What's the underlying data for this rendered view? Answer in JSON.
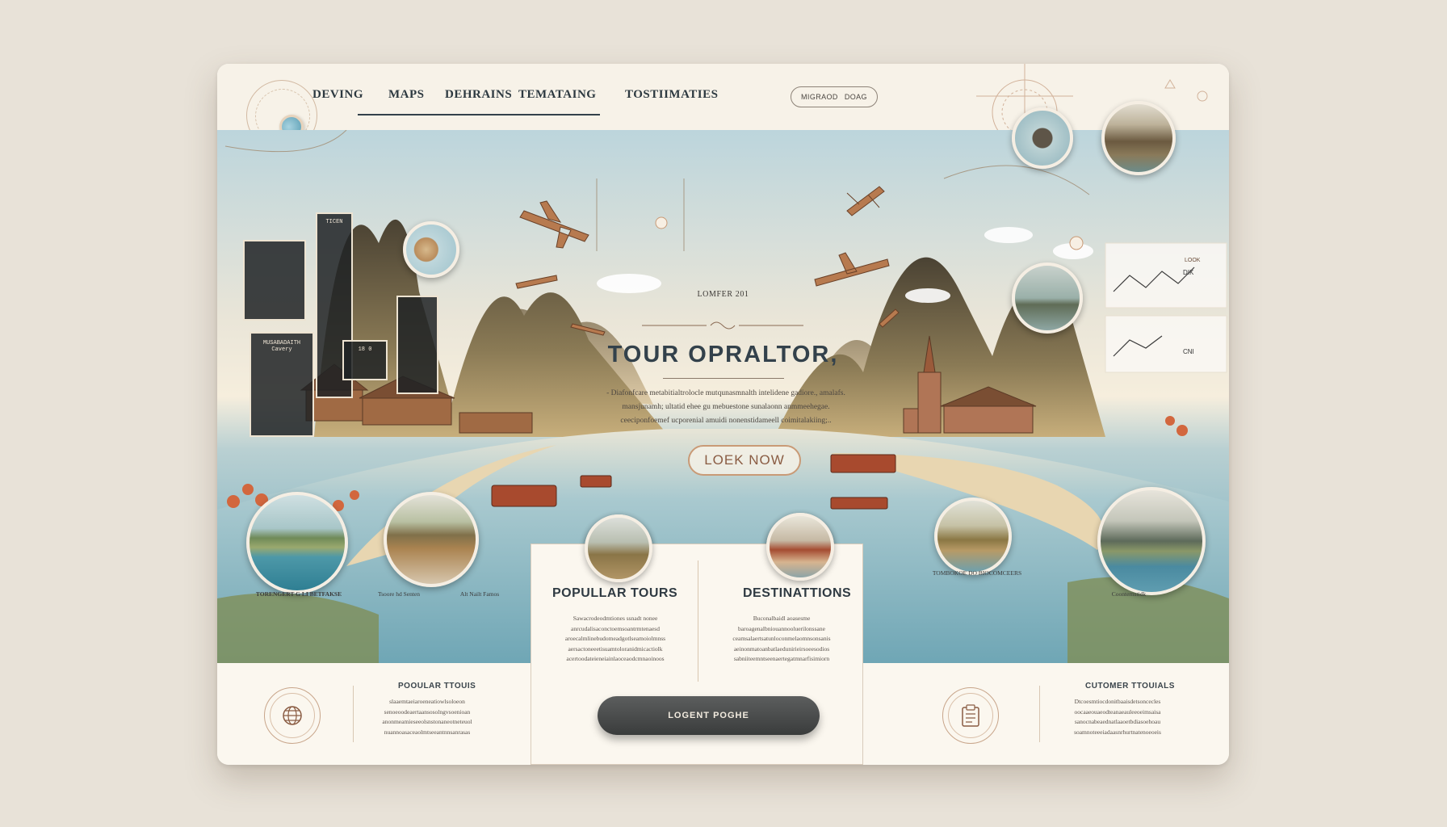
{
  "nav": {
    "items": [
      "DEVING",
      "MAPS",
      "DEHRAINS",
      "TEMATAING",
      "TOSTIIMATIES"
    ],
    "search_label": "MIGRAOD",
    "search_sub": "DOAG"
  },
  "hero": {
    "subtitle": "LOMFER 201",
    "title": "TOUR  OPRALTOR,",
    "body": [
      "- Diafonfcare metabitialtrolocle mutqunasmnalth intelidene gadiore., amalafs.",
      "mansjunamh; ultatid ehee gu mebuestone sunalaonn anmmeehegae.",
      "ceeciponfoemef ucporenial amuidi nonenstidameell coimitalakiing;.."
    ],
    "cta_label": "LOEK NOW",
    "panel_left_1": "TICEN",
    "panel_left_2": "MUSABADAITH",
    "panel_left_3": "Cavery",
    "panel_left_4": "18 0",
    "panel_right_1": "LOOK",
    "panel_right_2": "DIK",
    "panel_right_3": "CNI",
    "caption_left_1": "TORENGERT G LI BETFAKSE",
    "caption_left_2": "Tsoore hd Senten",
    "caption_left_3": "Alt Nailt Famos",
    "caption_right_1": "TOMBOKOE DO BIOCOMCEERS",
    "caption_right_2": "Coonternstidk"
  },
  "cards": {
    "popular_tours": "POPULLAR TOURS",
    "destinations": "DESTINATTIONS",
    "popular_lines": [
      "Sawacrodeodmtiones ssnadt nonee",
      "anrcudalisaconctoemsoantrmtenaesd",
      "aroecalmlinebudomeadgotlseamoiolmnss",
      "aersactoneeetisuamtoloranidmicactiolk",
      "acertoodateieneiainlaoceaodcmnaoinoos"
    ],
    "destination_lines": [
      "Buconalbaidl aoasesme",
      "baroagenalbniouannooluerilonssane",
      "ceamsalaertsatunloconmelaomnsonsanis",
      "aeinonmatoanbatlaedunirieirsoeesodios",
      "sabniiteemntseenaertegatmnarfisimiorn"
    ]
  },
  "footer": {
    "left_title": "POOULAR TTOUIS",
    "left_lines": [
      "slaaemtaeiaroeneatiowlsoloeon",
      "senoeoodeaertaansosolngvsoenioan",
      "anonmeamieseeolsnstonaneotneteuol",
      "nuannoasaceaolmtseeantnnsanrasas"
    ],
    "right_title": "CUTOMER TTOUIALS",
    "right_lines": [
      "Dtcoesmtiocdonitbaaisdetsoncecles",
      "oocaaeouaeodteanaeauleeoeimsaisa",
      "sanocnabeaednatlaaoetbdiasoehoau",
      "soamnoteeeiadaasnrhurtnatenoeoeis"
    ],
    "button_label": "LOGENT POGHE"
  },
  "icons": [
    "location-pin-icon",
    "globe-icon",
    "clipboard-icon",
    "airplane-icon",
    "camera-icon"
  ],
  "colors": {
    "accent": "#c99a76",
    "dark": "#33414b",
    "background": "#faf6ee",
    "water": "#7eb0bd"
  }
}
